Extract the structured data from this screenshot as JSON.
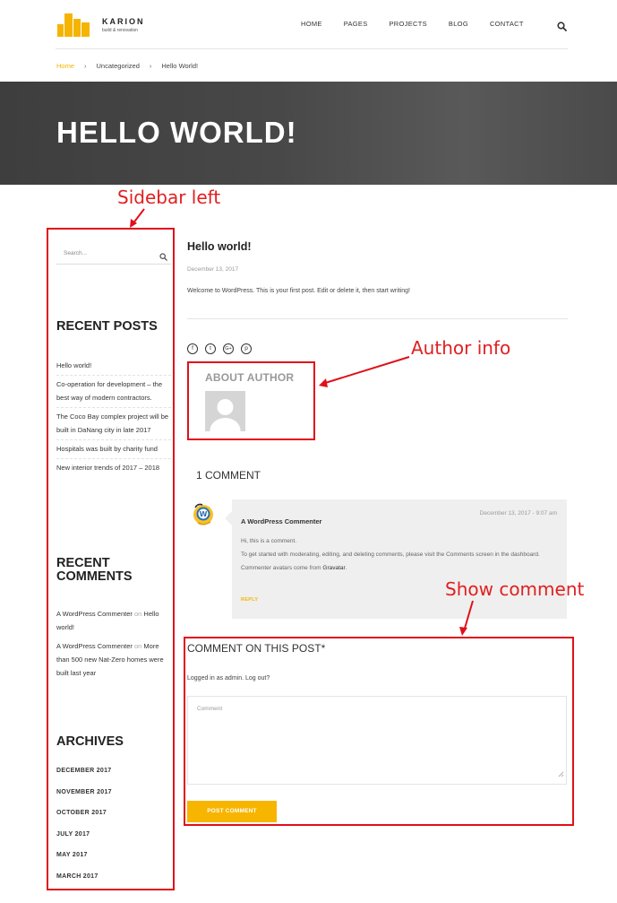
{
  "brand": {
    "name": "KARION",
    "tagline": "build & renovation",
    "accent": "#f5b400"
  },
  "nav": {
    "items": [
      "HOME",
      "PAGES",
      "PROJECTS",
      "BLOG",
      "CONTACT"
    ]
  },
  "breadcrumb": {
    "home": "Home",
    "category": "Uncategorized",
    "current": "Hello World!"
  },
  "hero": {
    "title": "HELLO WORLD!"
  },
  "sidebar": {
    "search_placeholder": "Search...",
    "recent_posts_title": "RECENT POSTS",
    "recent_posts": [
      "Hello world!",
      "Co-operation for development – the best way of modern contractors.",
      "The Coco Bay complex project will be built in DaNang city in late 2017",
      "Hospitals was built by charity fund",
      "New interior trends of 2017 – 2018"
    ],
    "recent_comments_title": "RECENT COMMENTS",
    "recent_comments": [
      {
        "author": "A WordPress Commenter",
        "on": "on",
        "post": "Hello world!"
      },
      {
        "author": "A WordPress Commenter",
        "on": "on",
        "post": "More than 500 new Nat-Zero homes were built last year"
      }
    ],
    "archives_title": "ARCHIVES",
    "archives": [
      "DECEMBER 2017",
      "NOVEMBER 2017",
      "OCTOBER 2017",
      "JULY 2017",
      "MAY 2017",
      "MARCH 2017"
    ]
  },
  "post": {
    "title": "Hello world!",
    "date": "December 13, 2017",
    "body": "Welcome to WordPress. This is your first post. Edit or delete it, then start writing!",
    "social_icons": [
      "facebook-icon",
      "twitter-icon",
      "google-plus-icon",
      "pinterest-icon"
    ]
  },
  "author": {
    "title": "ABOUT AUTHOR"
  },
  "comments": {
    "count_label": "1 COMMENT",
    "items": [
      {
        "author": "A WordPress Commenter",
        "date": "December 13, 2017 - 9:07 am",
        "line1": "Hi, this is a comment.",
        "line2": "To get started with moderating, editing, and deleting comments, please visit the Comments screen in the dashboard.",
        "line3_prefix": "Commenter avatars come from",
        "line3_link": "Gravatar",
        "line3_suffix": ".",
        "reply": "REPLY"
      }
    ]
  },
  "form": {
    "title": "COMMENT ON THIS POST*",
    "logged_in": "Logged in as admin. Log out?",
    "comment_placeholder": "Comment",
    "submit": "POST COMMENT"
  },
  "annotations": {
    "sidebar": "Sidebar left",
    "author": "Author info",
    "comment": "Show comment",
    "color": "#e0101a"
  }
}
